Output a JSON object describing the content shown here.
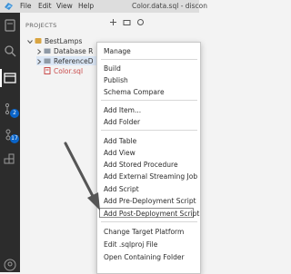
{
  "menubar": {
    "items": [
      {
        "label": "File"
      },
      {
        "label": "Edit"
      },
      {
        "label": "View"
      },
      {
        "label": "Help"
      }
    ],
    "window_title": "Color.data.sql - discon"
  },
  "activity_bar": {
    "source_control_badge": "2",
    "extensions_badge": "17"
  },
  "explorer": {
    "section_title": "PROJECTS",
    "tree": [
      {
        "label": "BestLamps"
      },
      {
        "label": "Database R"
      },
      {
        "label": "ReferenceD"
      },
      {
        "label": "Color.sql"
      }
    ]
  },
  "context_menu": {
    "items": [
      "Manage",
      "Build",
      "Publish",
      "Schema Compare",
      "Add Item...",
      "Add Folder",
      "Add Table",
      "Add View",
      "Add Stored Procedure",
      "Add External Streaming Job",
      "Add Script",
      "Add Pre-Deployment Script",
      "Add Post-Deployment Script",
      "Change Target Platform",
      "Edit .sqlproj File",
      "Open Containing Folder"
    ]
  },
  "colors": {
    "activity_bar": "#2c2c2c",
    "sidebar": "#f3f3f3",
    "badge": "#0a64c8",
    "menu_bg": "#ffffff"
  }
}
